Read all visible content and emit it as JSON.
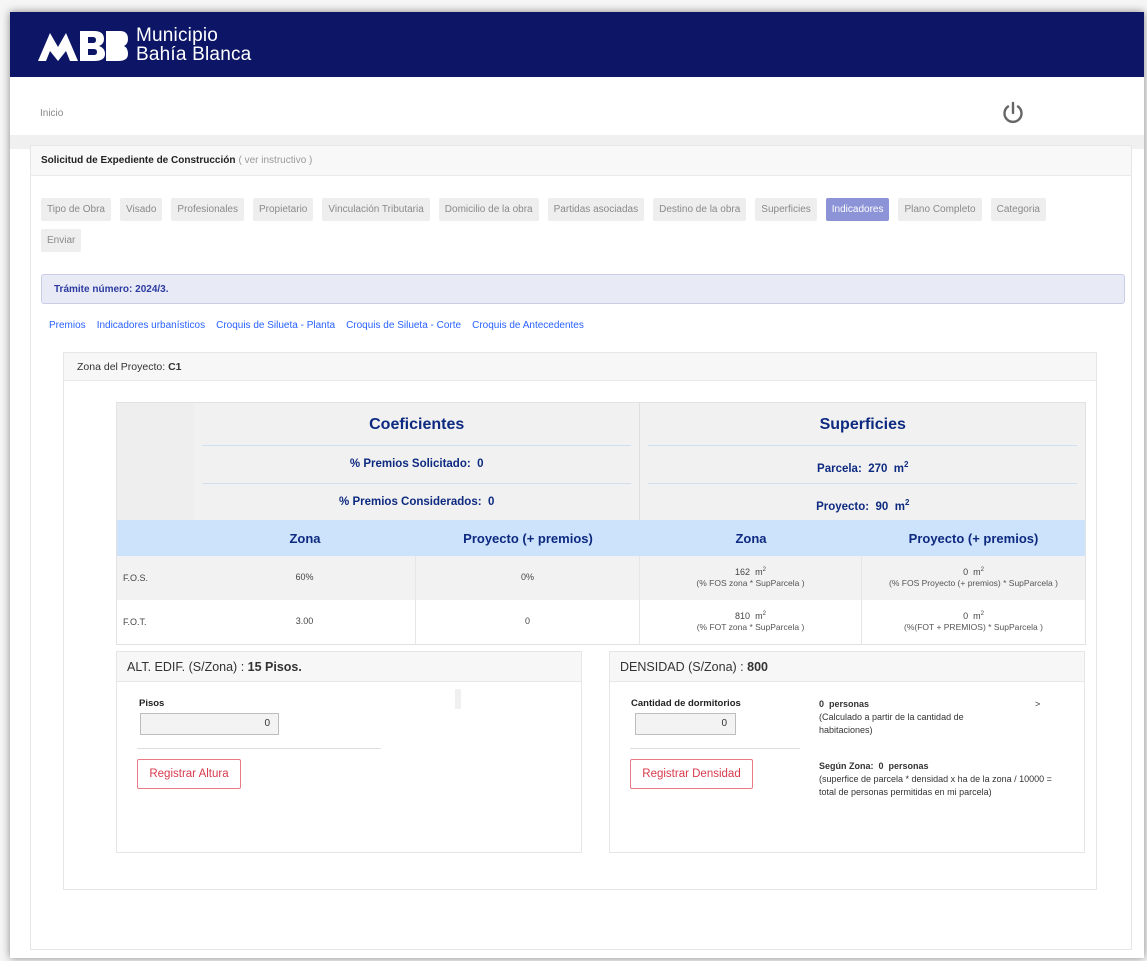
{
  "header": {
    "brand_line1": "Municipio",
    "brand_line2": "Bahía Blanca",
    "brand_color": "#0d1666"
  },
  "topnav": {
    "home_label": "Inicio",
    "power_icon": "power-icon"
  },
  "card": {
    "title": "Solicitud de Expediente de Construcción",
    "subtitle": "( ver instructivo )"
  },
  "steps": [
    {
      "label": "Tipo de Obra"
    },
    {
      "label": "Visado"
    },
    {
      "label": "Profesionales"
    },
    {
      "label": "Propietario"
    },
    {
      "label": "Vinculación Tributaria"
    },
    {
      "label": "Domicilio de la obra"
    },
    {
      "label": "Partidas asociadas"
    },
    {
      "label": "Destino de la obra"
    },
    {
      "label": "Superficies"
    },
    {
      "label": "Indicadores",
      "active": true
    },
    {
      "label": "Plano Completo"
    },
    {
      "label": "Categoria"
    },
    {
      "label": "Enviar"
    }
  ],
  "tramite": "Trámite número: 2024/3.",
  "sublinks": [
    "Premios",
    "Indicadores urbanísticos",
    "Croquis de Silueta - Planta",
    "Croquis de Silueta - Corte",
    "Croquis de Antecedentes"
  ],
  "zone": {
    "label": "Zona del Proyecto:",
    "value": "C1"
  },
  "coeficientes": {
    "title": "Coeficientes",
    "premios_solicitado_label": "% Premios Solicitado:",
    "premios_solicitado_value": "0",
    "premios_considerados_label": "% Premios Considerados:",
    "premios_considerados_value": "0"
  },
  "superficies": {
    "title": "Superficies",
    "parcela_label": "Parcela:",
    "parcela_value": "270",
    "unit": "m",
    "proyecto_label": "Proyecto:",
    "proyecto_value": "90"
  },
  "columns": [
    "Zona",
    "Proyecto (+ premios)",
    "Zona",
    "Proyecto (+ premios)"
  ],
  "rows": [
    {
      "name": "F.O.S.",
      "zona": "60%",
      "proyecto": "0%",
      "sup_zona": "162",
      "sup_zona_note": "(% FOS zona * SupParcela )",
      "sup_proy": "0",
      "sup_proy_note": "(% FOS Proyecto (+ premios) * SupParcela )"
    },
    {
      "name": "F.O.T.",
      "zona": "3.00",
      "proyecto": "0",
      "sup_zona": "810",
      "sup_zona_note": "(% FOT zona * SupParcela )",
      "sup_proy": "0",
      "sup_proy_note": "(%(FOT + PREMIOS) * SupParcela )"
    }
  ],
  "altura": {
    "title": "ALT. EDIF. (S/Zona) :",
    "title_value": "15 Pisos.",
    "field_label": "Pisos",
    "field_value": "0",
    "button": "Registrar Altura"
  },
  "densidad": {
    "title": "DENSIDAD (S/Zona) :",
    "title_value": "800",
    "field_label": "Cantidad de dormitorios",
    "field_value": "0",
    "button": "Registrar Densidad",
    "personas_value": "0",
    "personas_label": "personas",
    "arrow": ">",
    "personas_note": "(Calculado a partir de la cantidad de habitaciones)",
    "segun_label": "Según Zona:",
    "segun_value": "0",
    "segun_unit": "personas",
    "segun_note": "(superfice de parcela * densidad x ha de la zona / 10000 = total de personas permitidas en mi parcela)"
  }
}
